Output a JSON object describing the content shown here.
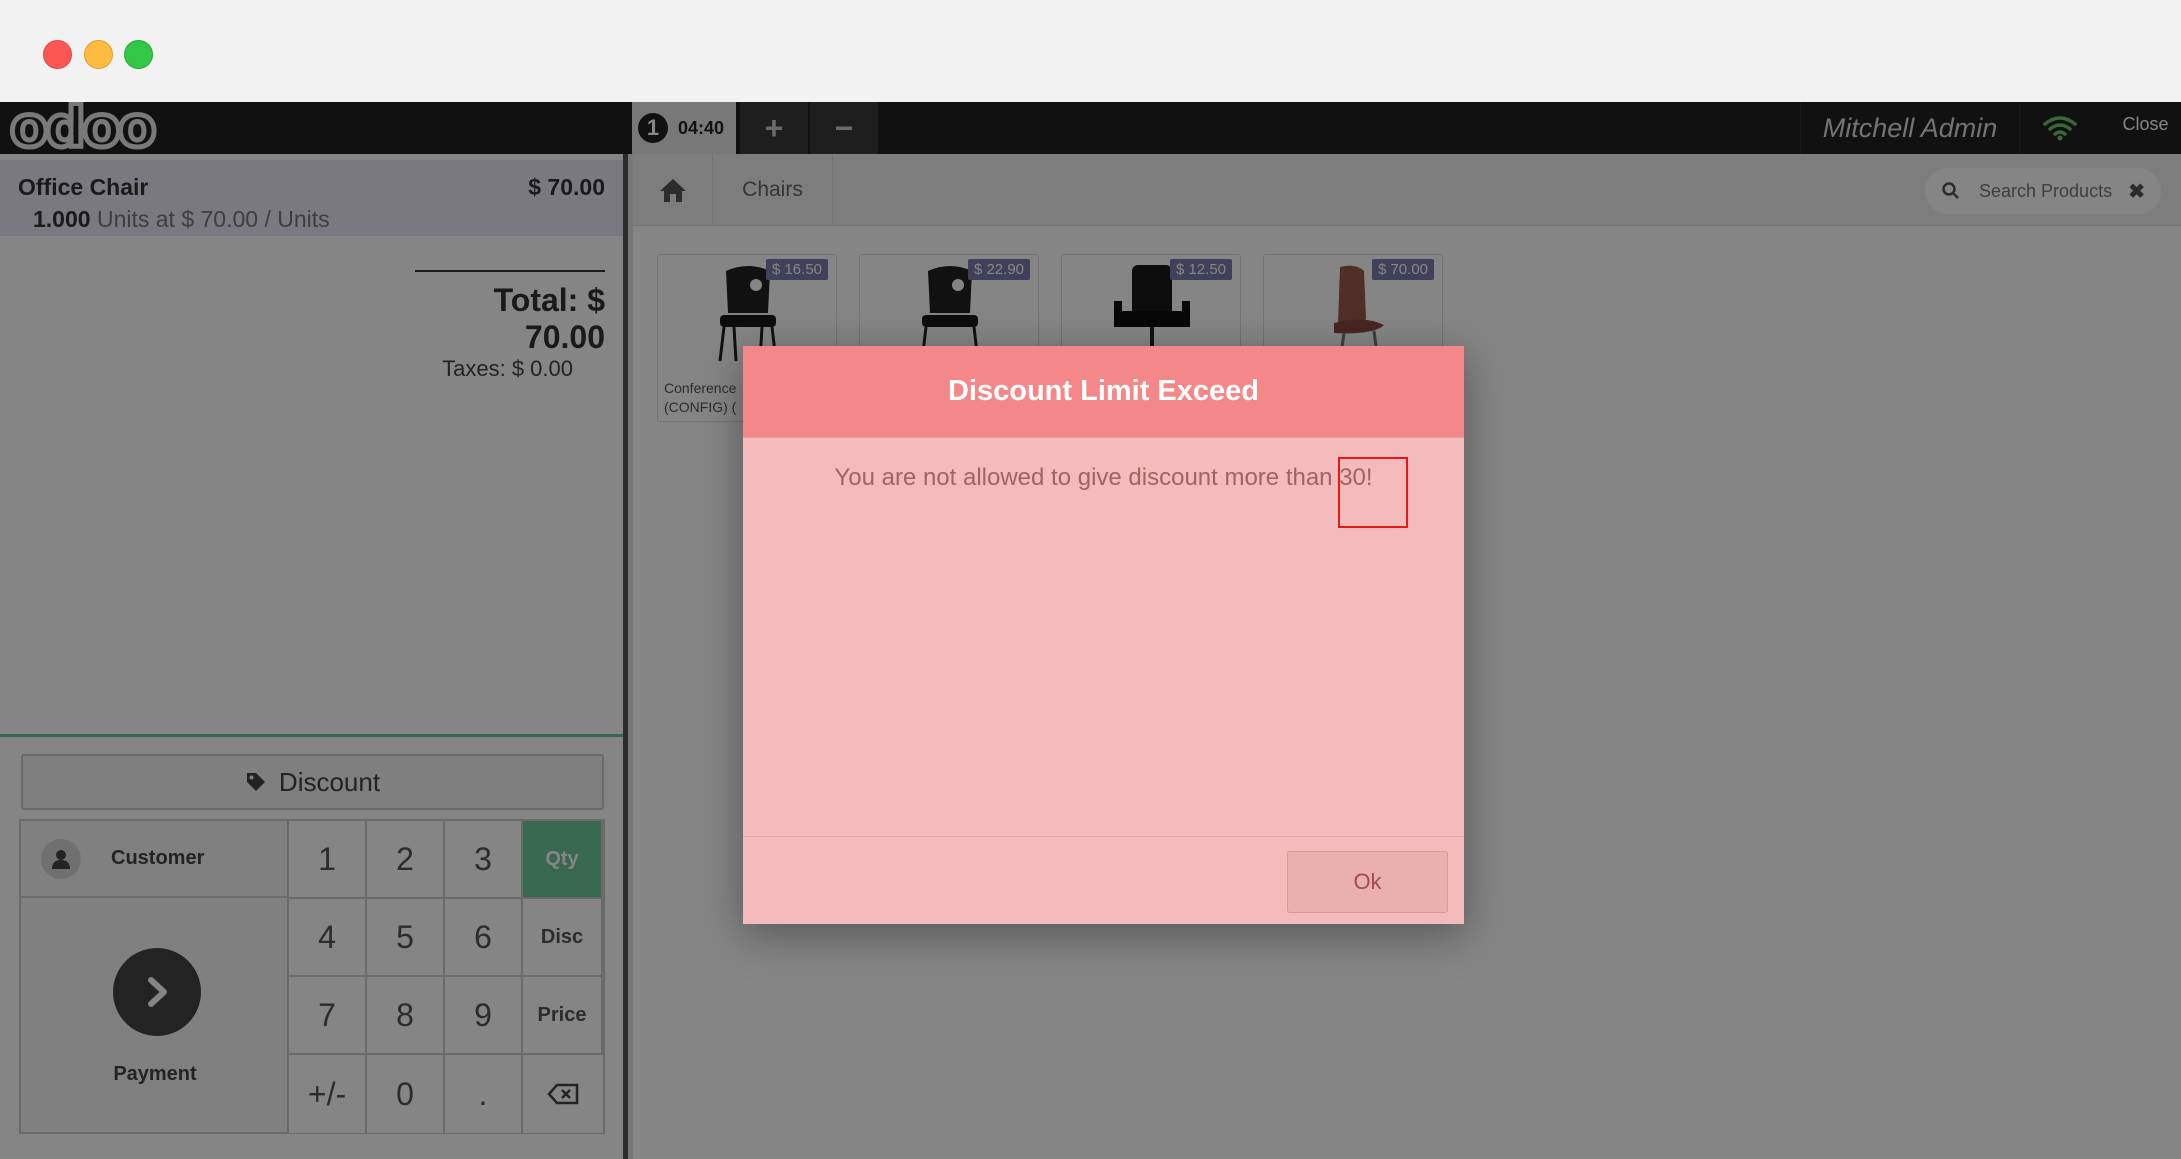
{
  "window": {
    "buttons": [
      "close",
      "minimize",
      "maximize"
    ]
  },
  "topbar": {
    "logo": "odoo",
    "order_number": "1",
    "order_time": "04:40",
    "add_order": "+",
    "remove_order": "−",
    "user": "Mitchell Admin",
    "wifi_icon": "wifi-icon",
    "close_label": "Close"
  },
  "order": {
    "line": {
      "product": "Office Chair",
      "price": "$ 70.00",
      "quantity": "1.000",
      "unit_info": "Units at $ 70.00 / Units"
    },
    "total": "Total: $ 70.00",
    "taxes": "Taxes: $ 0.00"
  },
  "controls": {
    "discount_label": "Discount",
    "customer_label": "Customer",
    "payment_label": "Payment",
    "numpad": [
      "1",
      "2",
      "3",
      "4",
      "5",
      "6",
      "7",
      "8",
      "9",
      "+/-",
      "0",
      "."
    ],
    "modes": [
      "Qty",
      "Disc",
      "Price"
    ],
    "active_mode": "Qty"
  },
  "products_bar": {
    "category": "Chairs",
    "search_placeholder": "Search Products",
    "clear_icon": "✖"
  },
  "products": [
    {
      "price": "$ 16.50",
      "name_line1": "Conference",
      "name_line2": "(CONFIG) ("
    },
    {
      "price": "$ 22.90",
      "name_line1": "",
      "name_line2": ""
    },
    {
      "price": "$ 12.50",
      "name_line1": "",
      "name_line2": ""
    },
    {
      "price": "$ 70.00",
      "name_line1": "",
      "name_line2": ""
    }
  ],
  "dialog": {
    "title": "Discount Limit Exceed",
    "message": "You are not allowed to give discount more than 30!",
    "ok_label": "Ok"
  },
  "colors": {
    "accent_green": "#6ec89b",
    "dialog_header": "#f48788",
    "dialog_body": "#f3bbbb",
    "highlight": "#e31a1a"
  }
}
